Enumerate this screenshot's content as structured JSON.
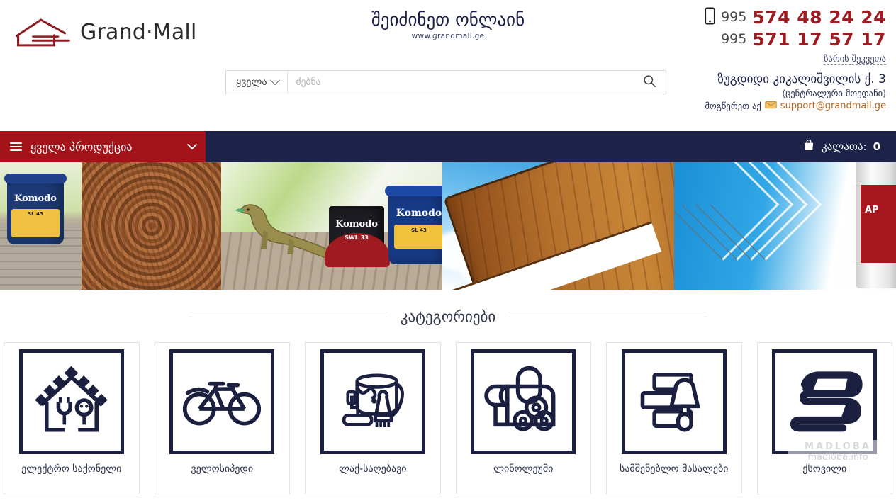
{
  "header": {
    "logo_text": "Grand·Mall",
    "logo_icon": "house-outline-logo",
    "tagline_ge": "შეიძინეთ ონლაინ",
    "website": "www.grandmall.ge",
    "phone_prefix_1": "995",
    "phone_1": "574 48 24 24",
    "phone_prefix_2": "995",
    "phone_2": "571 17 57 17",
    "callback_label": "ზარის შეკვეთა",
    "address_line": "ზუგდიდი კიკალიშვილის ქ. 3",
    "address_sub": "(ცენტრალური მოედანი)",
    "mail_prefix": "მოგწერეთ აქ",
    "email": "support@grandmall.ge",
    "phone_icon": "mobile-phone-icon",
    "mail_icon": "envelope-icon"
  },
  "search": {
    "category_label": "ყველა",
    "category_chevron": "chevron-down-icon",
    "placeholder": "ძებნა",
    "value": "",
    "button_icon": "search-icon"
  },
  "nav": {
    "menu_icon": "hamburger-icon",
    "all_products_label": "ყველა პროდუქცია",
    "chevron": "chevron-down-icon",
    "cart_icon": "shopping-bag-icon",
    "cart_label": "კალათა:",
    "cart_count": "0",
    "bar_color": "#1e2449",
    "accent_color": "#a5131a"
  },
  "banner": {
    "slides": [
      {
        "name": "komodo-bucket-deck",
        "brand": "Komodo",
        "code": "SL 43"
      },
      {
        "name": "wood-tree-rings"
      },
      {
        "name": "komodo-lizard-cans",
        "brand": "Komodo",
        "code_dark": "SWL 33",
        "code_blue": "SL 43"
      },
      {
        "name": "varnished-boat-hull-sky"
      },
      {
        "name": "blue-chevrons-varnish-can",
        "label": "AP"
      }
    ]
  },
  "categories": {
    "title": "კატეგორიები",
    "items": [
      {
        "label": "ელექტრო საქონელი",
        "icon": "house-electric-plug-socket-icon"
      },
      {
        "label": "ველოსიპედი",
        "icon": "bicycle-icon"
      },
      {
        "label": "ლაქ-საღებავი",
        "icon": "paint-bucket-roller-brush-icon"
      },
      {
        "label": "ლინოლეუმი",
        "icon": "linoleum-rolls-icon"
      },
      {
        "label": "სამშენებლო მასალები",
        "icon": "bricks-trowel-icon"
      },
      {
        "label": "ქსოვილი",
        "icon": "folded-fabric-icon"
      }
    ]
  },
  "watermark": {
    "line1": "MADLOBA",
    "line2": "madloba.info"
  }
}
